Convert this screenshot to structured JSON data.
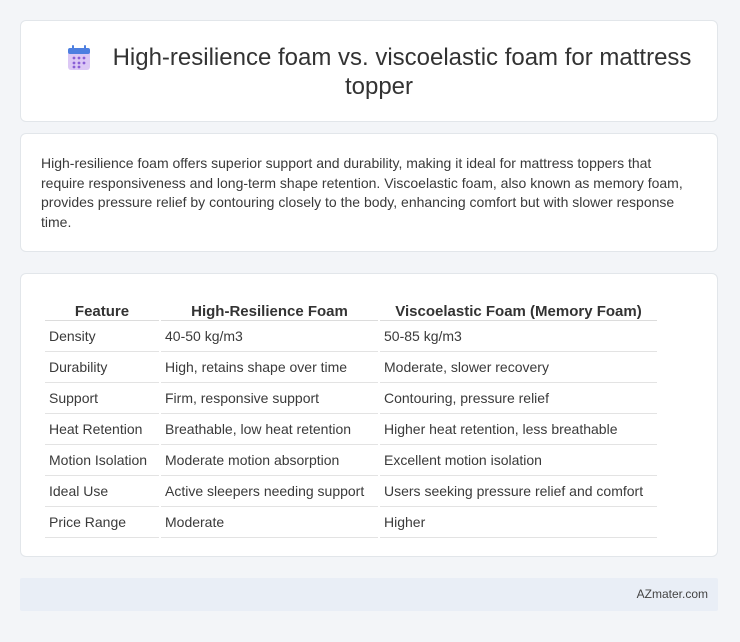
{
  "header": {
    "title": "High-resilience foam vs. viscoelastic foam for mattress topper",
    "icon": "calendar-icon"
  },
  "intro": {
    "text": "High-resilience foam offers superior support and durability, making it ideal for mattress toppers that require responsiveness and long-term shape retention. Viscoelastic foam, also known as memory foam, provides pressure relief by contouring closely to the body, enhancing comfort but with slower response time."
  },
  "table": {
    "headers": [
      "Feature",
      "High-Resilience Foam",
      "Viscoelastic Foam (Memory Foam)"
    ],
    "rows": [
      [
        "Density",
        "40-50 kg/m3",
        "50-85 kg/m3"
      ],
      [
        "Durability",
        "High, retains shape over time",
        "Moderate, slower recovery"
      ],
      [
        "Support",
        "Firm, responsive support",
        "Contouring, pressure relief"
      ],
      [
        "Heat Retention",
        "Breathable, low heat retention",
        "Higher heat retention, less breathable"
      ],
      [
        "Motion Isolation",
        "Moderate motion absorption",
        "Excellent motion isolation"
      ],
      [
        "Ideal Use",
        "Active sleepers needing support",
        "Users seeking pressure relief and comfort"
      ],
      [
        "Price Range",
        "Moderate",
        "Higher"
      ]
    ]
  },
  "footer": {
    "site": "AZmater.com"
  },
  "colors": {
    "icon_top": "#4d7fe0",
    "icon_body": "#c9a8ef",
    "icon_dots": "#8a5fd6"
  }
}
